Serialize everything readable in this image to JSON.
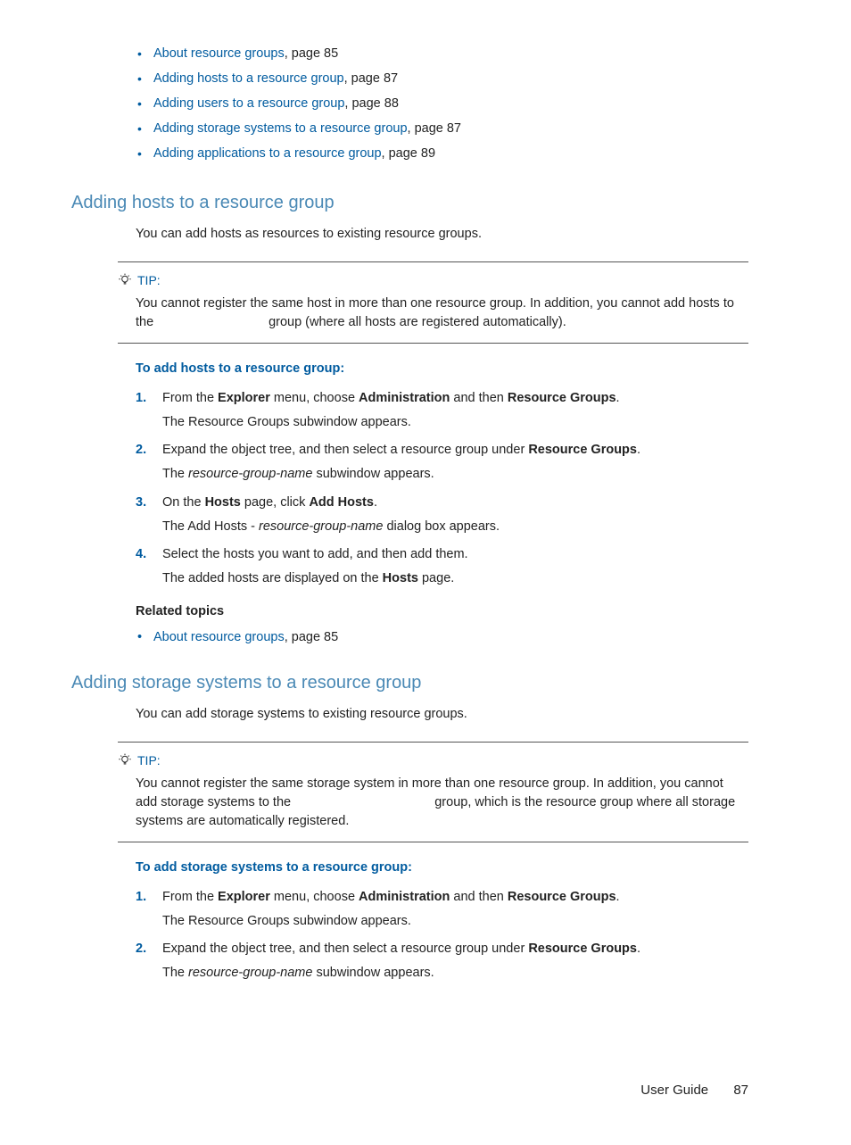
{
  "toc": [
    {
      "link": "About resource groups",
      "suffix": ", page 85"
    },
    {
      "link": "Adding hosts to a resource group",
      "suffix": ", page 87"
    },
    {
      "link": "Adding users to a resource group",
      "suffix": ", page 88"
    },
    {
      "link": "Adding storage systems to a resource group",
      "suffix": ", page 87"
    },
    {
      "link": "Adding applications to a resource group",
      "suffix": ", page 89"
    }
  ],
  "section1": {
    "heading": "Adding hosts to a resource group",
    "intro": "You can add hosts as resources to existing resource groups.",
    "tip_label": "TIP:",
    "tip_text": "You cannot register the same host in more than one resource group. In addition, you cannot add hosts to the                                group (where all hosts are registered automatically).",
    "sub_heading": "To add hosts to a resource group:",
    "steps": {
      "s1_a": "From the ",
      "s1_b": "Explorer",
      "s1_c": " menu, choose ",
      "s1_d": "Administration",
      "s1_e": " and then ",
      "s1_f": "Resource Groups",
      "s1_g": ".",
      "s1_sub": "The Resource Groups subwindow appears.",
      "s2_a": "Expand the object tree, and then select a resource group under ",
      "s2_b": "Resource Groups",
      "s2_c": ".",
      "s2_sub_a": "The ",
      "s2_sub_b": "resource-group-name",
      "s2_sub_c": " subwindow appears.",
      "s3_a": "On the ",
      "s3_b": "Hosts",
      "s3_c": " page, click ",
      "s3_d": "Add Hosts",
      "s3_e": ".",
      "s3_sub_a": "The Add Hosts - ",
      "s3_sub_b": "resource-group-name",
      "s3_sub_c": " dialog box appears.",
      "s4_a": "Select the hosts you want to add, and then add them.",
      "s4_sub_a": "The added hosts are displayed on the ",
      "s4_sub_b": "Hosts",
      "s4_sub_c": " page."
    },
    "related_heading": "Related topics",
    "related": [
      {
        "link": "About resource groups",
        "suffix": ", page 85"
      }
    ]
  },
  "section2": {
    "heading": "Adding storage systems to a resource group",
    "intro": "You can add storage systems to existing resource groups.",
    "tip_label": "TIP:",
    "tip_text": "You cannot register the same storage system in more than one resource group. In addition, you cannot add storage systems to the                                        group, which is the resource group where all storage systems are automatically registered.",
    "sub_heading": "To add storage systems to a resource group:",
    "steps": {
      "s1_a": "From the ",
      "s1_b": "Explorer",
      "s1_c": " menu, choose ",
      "s1_d": "Administration",
      "s1_e": " and then ",
      "s1_f": "Resource Groups",
      "s1_g": ".",
      "s1_sub": "The Resource Groups subwindow appears.",
      "s2_a": "Expand the object tree, and then select a resource group under ",
      "s2_b": "Resource Groups",
      "s2_c": ".",
      "s2_sub_a": "The ",
      "s2_sub_b": "resource-group-name",
      "s2_sub_c": " subwindow appears."
    }
  },
  "footer": {
    "title": "User Guide",
    "page": "87"
  }
}
